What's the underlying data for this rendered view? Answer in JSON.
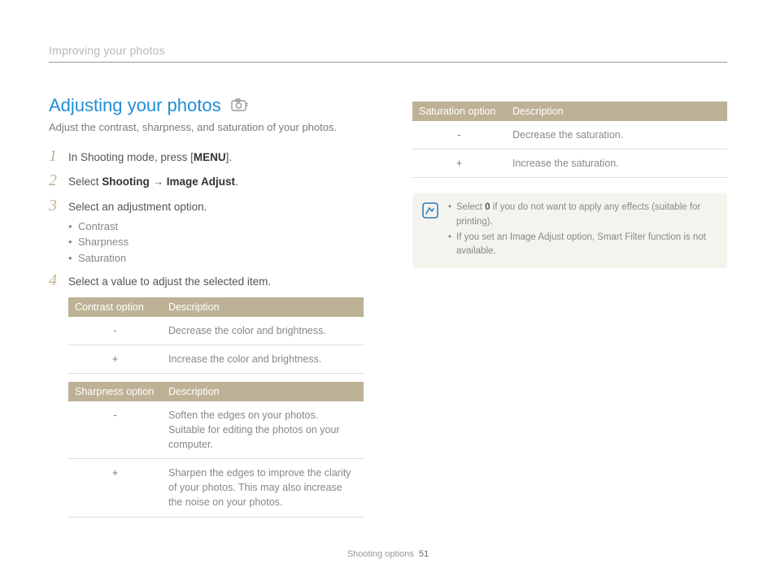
{
  "breadcrumb": "Improving your photos",
  "section": {
    "title": "Adjusting your photos",
    "subtitle": "Adjust the contrast, sharpness, and saturation of your photos."
  },
  "steps": {
    "s1_pre": "In Shooting mode, press [",
    "s1_menu": "MENU",
    "s1_post": "].",
    "s2_pre": "Select ",
    "s2_b1": "Shooting",
    "s2_arrow": " → ",
    "s2_b2": "Image Adjust",
    "s2_post": ".",
    "s3": "Select an adjustment option.",
    "s3_bullets": {
      "b0": "Contrast",
      "b1": "Sharpness",
      "b2": "Saturation"
    },
    "s4": "Select a value to adjust the selected item."
  },
  "tables": {
    "contrast": {
      "h0": "Contrast option",
      "h1": "Description",
      "r0c0": "-",
      "r0c1": "Decrease the color and brightness.",
      "r1c0": "+",
      "r1c1": "Increase the color and brightness."
    },
    "sharpness": {
      "h0": "Sharpness option",
      "h1": "Description",
      "r0c0": "-",
      "r0c1": "Soften the edges on your photos. Suitable for editing the photos on your computer.",
      "r1c0": "+",
      "r1c1": "Sharpen the edges to improve the clarity of your photos. This may also increase the noise on your photos."
    },
    "saturation": {
      "h0": "Saturation option",
      "h1": "Description",
      "r0c0": "-",
      "r0c1": "Decrease the saturation.",
      "r1c0": "+",
      "r1c1": "Increase the saturation."
    }
  },
  "note": {
    "l0_pre": "Select ",
    "l0_b": "0",
    "l0_post": " if you do not want to apply any effects (suitable for printing).",
    "l1": "If you set an Image Adjust option, Smart Filter function is not available."
  },
  "footer": {
    "section": "Shooting options",
    "page": "51"
  }
}
